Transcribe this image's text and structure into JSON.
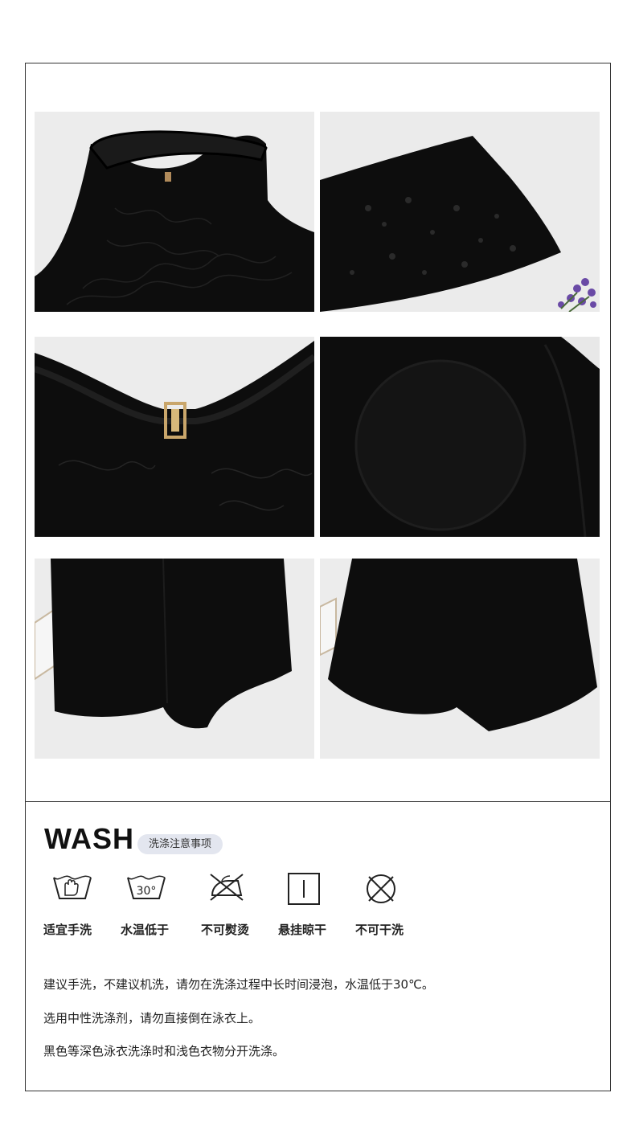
{
  "wash": {
    "title": "WASH",
    "subtitle": "洗涤注意事项",
    "care_items": [
      {
        "icon": "hand-wash-icon",
        "label": "适宜手洗"
      },
      {
        "icon": "water-temp-30-icon",
        "label": "水温低于",
        "icon_text": "30°"
      },
      {
        "icon": "no-iron-icon",
        "label": "不可熨烫"
      },
      {
        "icon": "hang-dry-icon",
        "label": "悬挂晾干"
      },
      {
        "icon": "no-dry-clean-icon",
        "label": "不可干洗"
      }
    ],
    "notes": [
      "建议手洗，不建议机洗，请勿在洗涤过程中长时间浸泡，水温低于30℃。",
      "选用中性洗涤剂，请勿直接倒在泳衣上。",
      "黑色等深色泳衣洗涤时和浅色衣物分开洗涤。"
    ]
  },
  "photos": [
    {
      "name": "halter-neck-lace-photo"
    },
    {
      "name": "lace-hem-flower-photo"
    },
    {
      "name": "gold-buckle-photo"
    },
    {
      "name": "bra-pad-photo"
    },
    {
      "name": "shorts-front-photo"
    },
    {
      "name": "shorts-back-photo"
    }
  ],
  "colors": {
    "fabric": "#0d0d0d",
    "background": "#e9e9e9",
    "pill": "#e3e6ef",
    "border": "#333333"
  }
}
